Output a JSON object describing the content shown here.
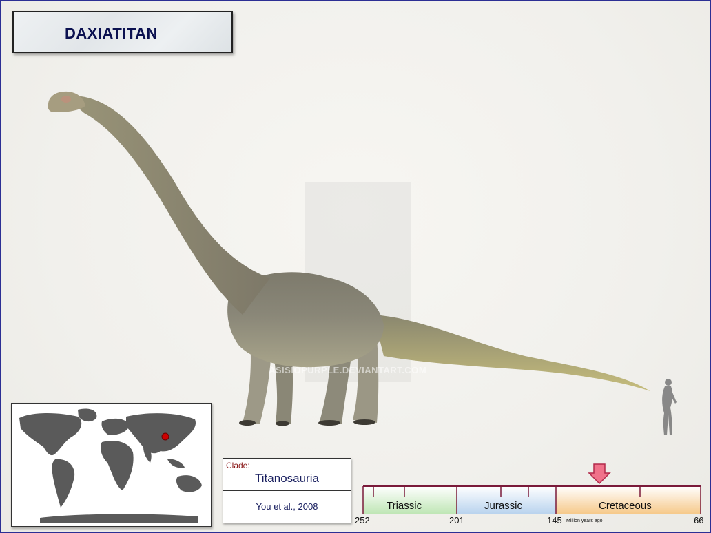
{
  "title": "DAXIATITAN",
  "watermark": "ASISIOPURPLE.DEVIANTART.COM",
  "clade": {
    "label": "Clade:",
    "value": "Titanosauria",
    "citation": "You et al., 2008"
  },
  "timeline": {
    "periods": [
      {
        "name": "Triassic",
        "color": "#bfe6b5"
      },
      {
        "name": "Jurassic",
        "color": "#b9d3ee"
      },
      {
        "name": "Cretaceous",
        "color": "#f6c98a"
      }
    ],
    "ticks": [
      "252",
      "201",
      "145",
      "66"
    ],
    "unit": "Million years ago"
  },
  "map": {
    "marker_color": "#cc0000",
    "land_color": "#5a5a5a"
  }
}
